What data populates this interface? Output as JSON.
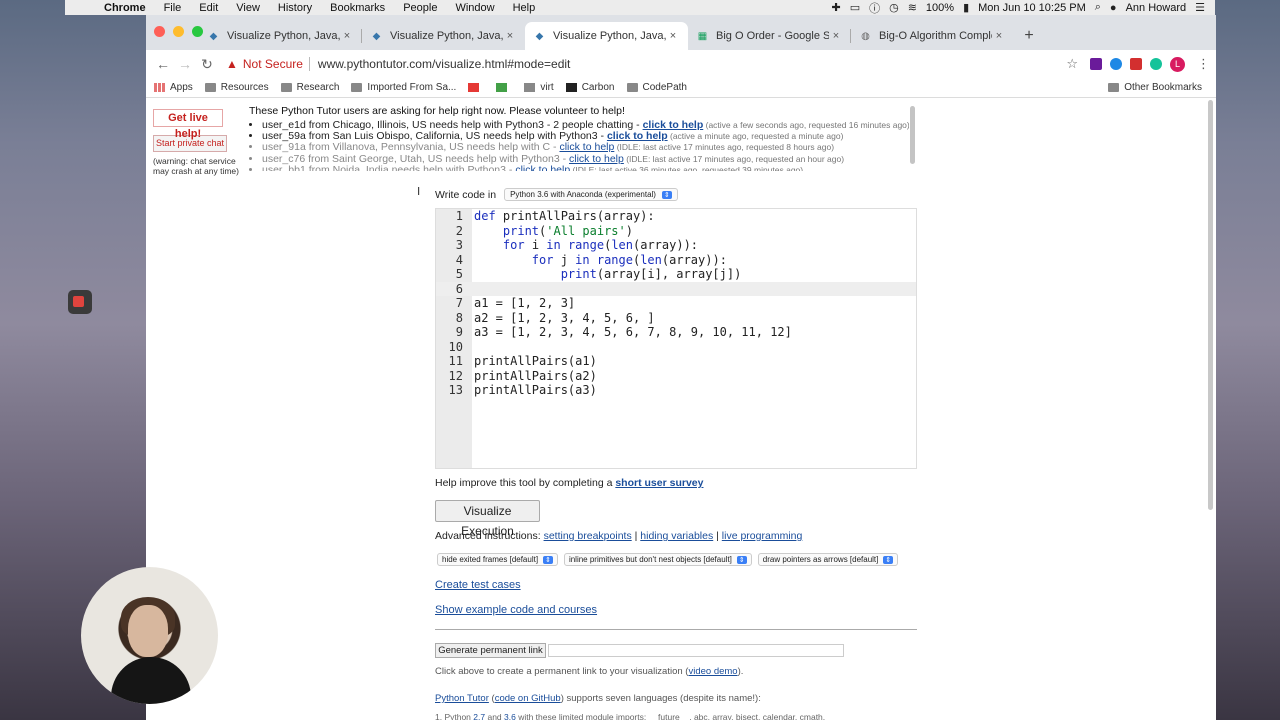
{
  "menubar": {
    "app": "Chrome",
    "items": [
      "File",
      "Edit",
      "View",
      "History",
      "Bookmarks",
      "People",
      "Window",
      "Help"
    ],
    "battery": "100%",
    "clock": "Mon Jun 10  10:25 PM",
    "user": "Ann Howard"
  },
  "tabs": [
    {
      "label": "Visualize Python, Java, JavaSc",
      "active": false
    },
    {
      "label": "Visualize Python, Java, JavaSc",
      "active": false
    },
    {
      "label": "Visualize Python, Java, JavaSc",
      "active": true
    },
    {
      "label": "Big O Order - Google Sheets",
      "active": false
    },
    {
      "label": "Big-O Algorithm Complexity Ch",
      "active": false
    }
  ],
  "toolbar": {
    "security": "Not Secure",
    "url": "www.pythontutor.com/visualize.html#mode=edit",
    "profile_initial": "L"
  },
  "bookmarks": {
    "items": [
      "Apps",
      "Resources",
      "Research",
      "Imported From Sa...",
      "virt",
      "Carbon",
      "CodePath"
    ],
    "other": "Other Bookmarks"
  },
  "help": {
    "live_button": "Get live help!",
    "chat_button": "Start private chat",
    "chat_warning_1": "(warning: chat service",
    "chat_warning_2": "may crash at any time)",
    "heading": "These Python Tutor users are asking for help right now. Please volunteer to help!",
    "requests": [
      {
        "text": "user_e1d from Chicago, Illinois, US needs help with Python3 - 2 people chatting - ",
        "link": "click to help",
        "meta": " (active a few seconds ago, requested 16 minutes ago)",
        "idle": false
      },
      {
        "text": "user_59a from San Luis Obispo, California, US needs help with Python3 - ",
        "link": "click to help",
        "meta": " (active a minute ago, requested a minute ago)",
        "idle": false
      },
      {
        "text": "user_91a from Villanova, Pennsylvania, US needs help with C - ",
        "link": "click to help",
        "meta": " (IDLE: last active 17 minutes ago, requested 8 hours ago)",
        "idle": true
      },
      {
        "text": "user_c76 from Saint George, Utah, US needs help with Python3 - ",
        "link": "click to help",
        "meta": " (IDLE: last active 17 minutes ago, requested an hour ago)",
        "idle": true
      },
      {
        "text": "user_bb1 from Noida, India needs help with Python3 - ",
        "link": "click to help",
        "meta": " (IDLE: last active 36 minutes ago, requested 39 minutes ago)",
        "idle": true
      }
    ]
  },
  "editor": {
    "write_label": "Write code in",
    "language": "Python 3.6 with Anaconda (experimental)",
    "cursor_line": 6,
    "lines": [
      [
        {
          "t": "def ",
          "c": "kw"
        },
        {
          "t": "printAllPairs(array):",
          "c": ""
        }
      ],
      [
        {
          "t": "    ",
          "c": ""
        },
        {
          "t": "print",
          "c": "kw"
        },
        {
          "t": "(",
          "c": ""
        },
        {
          "t": "'All pairs'",
          "c": "str"
        },
        {
          "t": ")",
          "c": ""
        }
      ],
      [
        {
          "t": "    ",
          "c": ""
        },
        {
          "t": "for ",
          "c": "kw"
        },
        {
          "t": "i ",
          "c": ""
        },
        {
          "t": "in ",
          "c": "kw"
        },
        {
          "t": "range",
          "c": "kw"
        },
        {
          "t": "(",
          "c": ""
        },
        {
          "t": "len",
          "c": "kw"
        },
        {
          "t": "(array)):",
          "c": ""
        }
      ],
      [
        {
          "t": "        ",
          "c": ""
        },
        {
          "t": "for ",
          "c": "kw"
        },
        {
          "t": "j ",
          "c": ""
        },
        {
          "t": "in ",
          "c": "kw"
        },
        {
          "t": "range",
          "c": "kw"
        },
        {
          "t": "(",
          "c": ""
        },
        {
          "t": "len",
          "c": "kw"
        },
        {
          "t": "(array)):",
          "c": ""
        }
      ],
      [
        {
          "t": "            ",
          "c": ""
        },
        {
          "t": "print",
          "c": "kw"
        },
        {
          "t": "(array[i], array[j])",
          "c": ""
        }
      ],
      [],
      [
        {
          "t": "a1 = [1, 2, 3]",
          "c": ""
        }
      ],
      [
        {
          "t": "a2 = [1, 2, 3, 4, 5, 6, ]",
          "c": ""
        }
      ],
      [
        {
          "t": "a3 = [1, 2, 3, 4, 5, 6, 7, 8, 9, 10, 11, 12]",
          "c": ""
        }
      ],
      [],
      [
        {
          "t": "printAllPairs(a1)",
          "c": ""
        }
      ],
      [
        {
          "t": "printAllPairs(a2)",
          "c": ""
        }
      ],
      [
        {
          "t": "printAllPairs(a3)",
          "c": ""
        }
      ]
    ]
  },
  "survey": {
    "text": "Help improve this tool by completing a ",
    "link": "short user survey"
  },
  "visualize_button": "Visualize Execution",
  "advanced": {
    "label": "Advanced instructions: ",
    "links": [
      "setting breakpoints",
      "hiding variables",
      "live programming"
    ],
    "sep": " | "
  },
  "options": [
    "hide exited frames [default]",
    "inline primitives but don't nest objects [default]",
    "draw pointers as arrows [default]"
  ],
  "links": {
    "test_cases": "Create test cases",
    "examples": "Show example code and courses"
  },
  "permalink": {
    "button": "Generate permanent link",
    "note_pre": "Click above to create a permanent link to your visualization (",
    "note_link": "video demo",
    "note_post": ")."
  },
  "footer": {
    "brand": "Python Tutor",
    "paren_open": " (",
    "github": "code on GitHub",
    "text": ") supports seven languages (despite its name!):",
    "line1_pre": "1. Python ",
    "v27": "2.7",
    "and": " and ",
    "v36": "3.6",
    "line1_post": " with these limited module imports: __future__, abc, array, bisect, calendar, cmath,"
  },
  "colors": {
    "link": "#1a4d9a",
    "alert": "#c5221f",
    "keyword": "#1b2fbd",
    "string": "#0a7e2d"
  }
}
